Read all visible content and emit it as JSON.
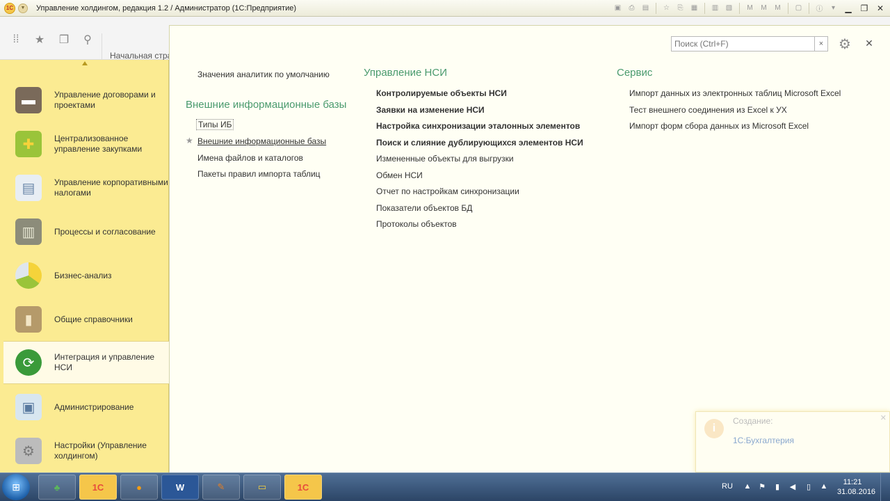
{
  "window": {
    "title": "Управление холдингом, редакция 1.2 / Администратор  (1С:Предприятие)",
    "logo_text": "1С"
  },
  "toolbar": {
    "home_tab": "Начальная стра"
  },
  "sidebar": {
    "items": [
      {
        "label": "Управление договорами и проектами",
        "icon": "briefcase-icon",
        "active": false
      },
      {
        "label": "Централизованное управление закупками",
        "icon": "gift-box-icon",
        "active": false
      },
      {
        "label": "Управление корпоративными налогами",
        "icon": "documents-icon",
        "active": false
      },
      {
        "label": "Процессы и согласование",
        "icon": "process-book-icon",
        "active": false
      },
      {
        "label": "Бизнес-анализ",
        "icon": "pie-chart-icon",
        "active": false
      },
      {
        "label": "Общие справочники",
        "icon": "reference-book-icon",
        "active": false
      },
      {
        "label": "Интеграция и управление НСИ",
        "icon": "sync-arrows-icon",
        "active": true
      },
      {
        "label": "Администрирование",
        "icon": "computer-icon",
        "active": false
      },
      {
        "label": "Настройки (Управление холдингом)",
        "icon": "gears-icon",
        "active": false
      }
    ]
  },
  "search": {
    "placeholder": "Поиск (Ctrl+F)"
  },
  "content": {
    "col1": {
      "top_link": "Значения аналитик по умолчанию",
      "section_title": "Внешние информационные базы",
      "links": [
        "Типы ИБ",
        "Внешние информационные базы",
        "Имена файлов и каталогов",
        "Пакеты правил импорта таблиц"
      ]
    },
    "col2": {
      "section_title": "Управление НСИ",
      "bold_links": [
        "Контролируемые объекты НСИ",
        "Заявки на изменение НСИ",
        "Настройка синхронизации эталонных элементов",
        "Поиск и слияние дублирующихся элементов НСИ"
      ],
      "links": [
        "Измененные объекты для выгрузки",
        "Обмен НСИ",
        "Отчет по настройкам синхронизации",
        "Показатели объектов БД",
        "Протоколы объектов"
      ]
    },
    "col3": {
      "section_title": "Сервис",
      "links": [
        "Импорт данных из электронных таблиц Microsoft Excel",
        "Тест внешнего соединения из Excel к УХ",
        "Импорт форм сбора данных из Microsoft Excel"
      ]
    }
  },
  "notification": {
    "title": "Создание:",
    "link": "1С:Бухгалтерия"
  },
  "taskbar": {
    "lang": "RU",
    "time": "11:21",
    "date": "31.08.2016",
    "apps": [
      {
        "name": "tree-app",
        "label": ""
      },
      {
        "name": "1c-app",
        "label": "1С"
      },
      {
        "name": "firefox",
        "label": ""
      },
      {
        "name": "word",
        "label": "W"
      },
      {
        "name": "paint",
        "label": ""
      },
      {
        "name": "explorer",
        "label": ""
      },
      {
        "name": "1c-app-2",
        "label": "1С"
      }
    ]
  },
  "colors": {
    "sidebar_bg": "#fbeb92",
    "section_title": "#4a9a6e",
    "panel_bg": "#fffff4"
  }
}
